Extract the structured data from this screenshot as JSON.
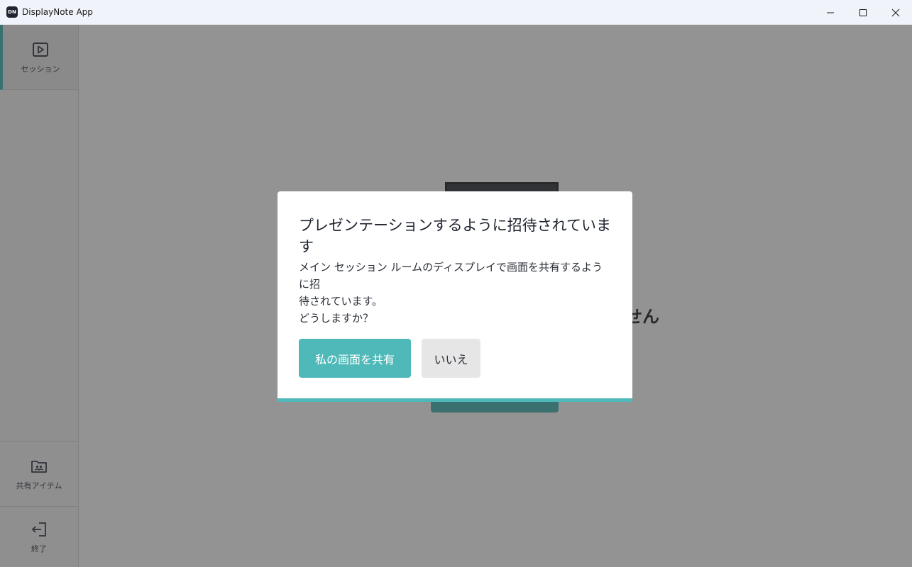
{
  "window": {
    "icon_text": "DN",
    "title": "DisplayNote App",
    "controls": [
      "minimize-icon",
      "maximize-icon",
      "close-icon"
    ]
  },
  "sidebar": {
    "items": [
      {
        "label": "セッション",
        "icon": "play-icon",
        "active": true
      },
      {
        "label": "共有アイテム",
        "icon": "shared-folder-icon",
        "active": false
      },
      {
        "label": "終了",
        "icon": "exit-icon",
        "active": false
      }
    ]
  },
  "background": {
    "partial_text": "せん"
  },
  "dialog": {
    "title": "プレゼンテーションするように招待されています",
    "body_lines": [
      "メイン セッション ルームのディスプレイで画面を共有するように招",
      "待されています。",
      "どうしますか？"
    ],
    "primary_label": "私の画面を共有",
    "secondary_label": "いいえ"
  },
  "colors": {
    "accent": "#4fb9b9",
    "overlay": "rgba(40,40,40,0.5)",
    "secondary_button": "#e6e6e6"
  }
}
